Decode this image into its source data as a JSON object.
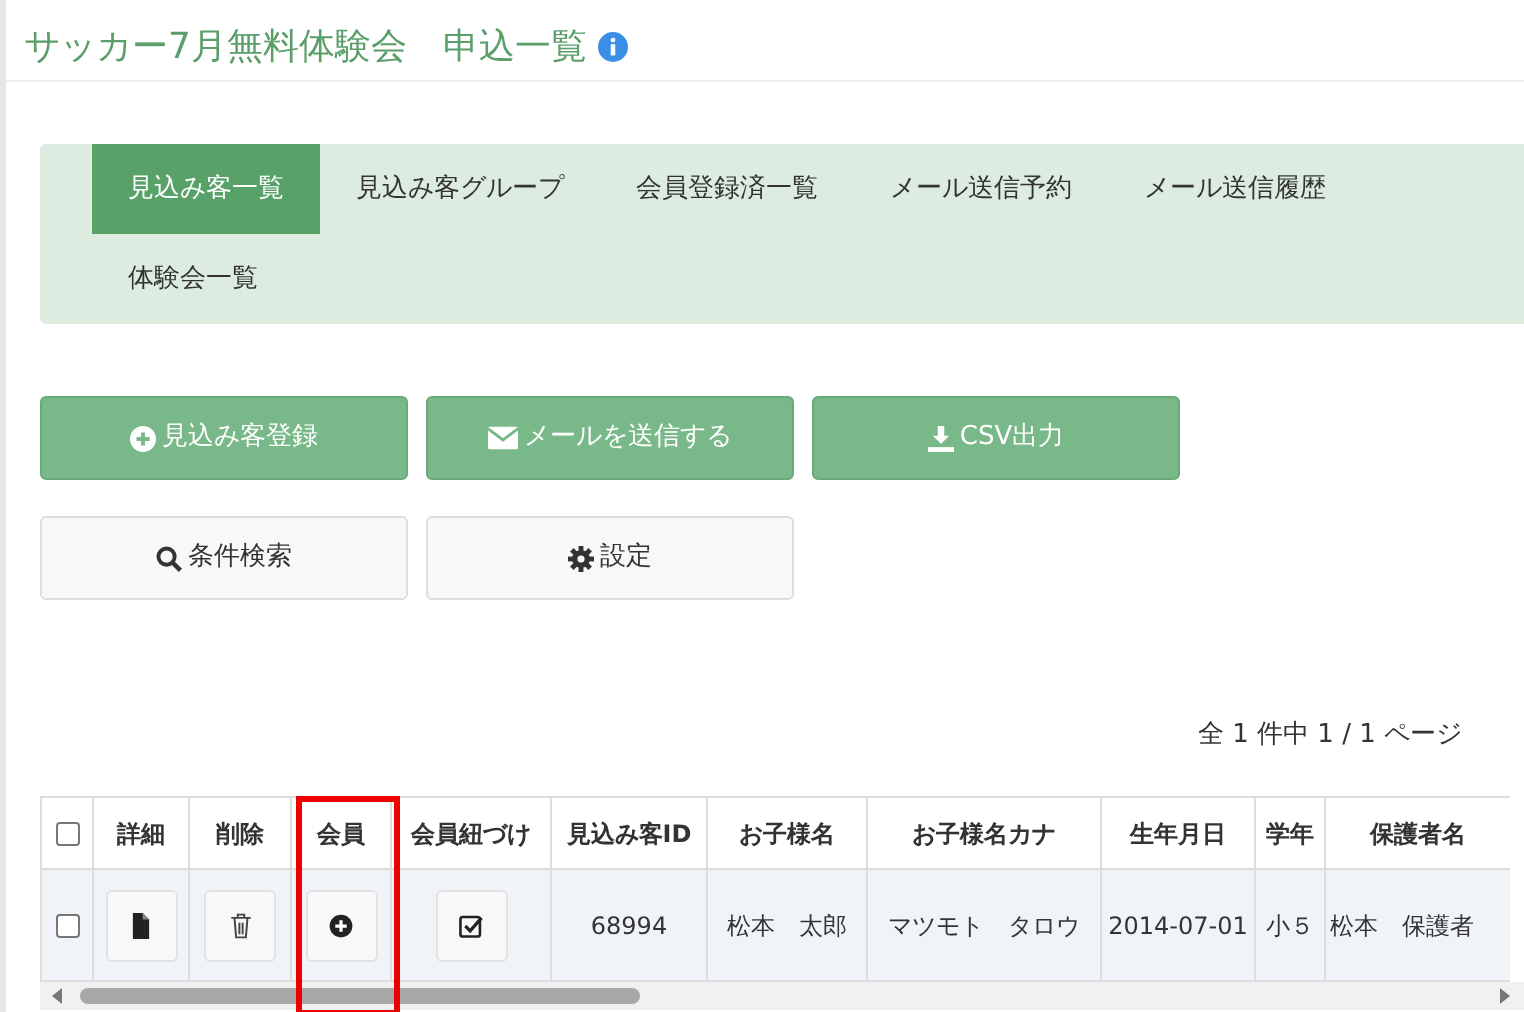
{
  "title": "サッカー7月無料体験会　申込一覧",
  "tabs": [
    {
      "label": "見込み客一覧",
      "selected": true
    },
    {
      "label": "見込み客グループ",
      "selected": false
    },
    {
      "label": "会員登録済一覧",
      "selected": false
    },
    {
      "label": "メール送信予約",
      "selected": false
    },
    {
      "label": "メール送信履歴",
      "selected": false
    },
    {
      "label": "体験会一覧",
      "selected": false
    }
  ],
  "actions": [
    {
      "label": "見込み客登録",
      "kind": "primary"
    },
    {
      "label": "メールを送信する",
      "kind": "primary"
    },
    {
      "label": "CSV出力",
      "kind": "primary"
    },
    {
      "label": "条件検索",
      "kind": "secondary"
    },
    {
      "label": "設定",
      "kind": "secondary"
    }
  ],
  "pager": "全 1 件中 1 / 1 ページ",
  "table": {
    "select_all_checked": false,
    "columns": [
      {
        "label": "詳細",
        "highlighted": false
      },
      {
        "label": "削除",
        "highlighted": false
      },
      {
        "label": "会員",
        "highlighted": true
      },
      {
        "label": "会員紐づけ",
        "highlighted": false
      },
      {
        "label": "見込み客ID",
        "highlighted": false
      },
      {
        "label": "お子様名",
        "highlighted": false
      },
      {
        "label": "お子様名カナ",
        "highlighted": false
      },
      {
        "label": "生年月日",
        "highlighted": false
      },
      {
        "label": "学年",
        "highlighted": false
      },
      {
        "label": "保護者名",
        "highlighted": false
      }
    ],
    "rows": [
      {
        "checked": false,
        "id": "68994",
        "child_name": "松本　太郎",
        "child_kana": "マツモト　タロウ",
        "birthday": "2014-07-01",
        "grade": "小５",
        "guardian": "松本　保護者"
      }
    ]
  }
}
